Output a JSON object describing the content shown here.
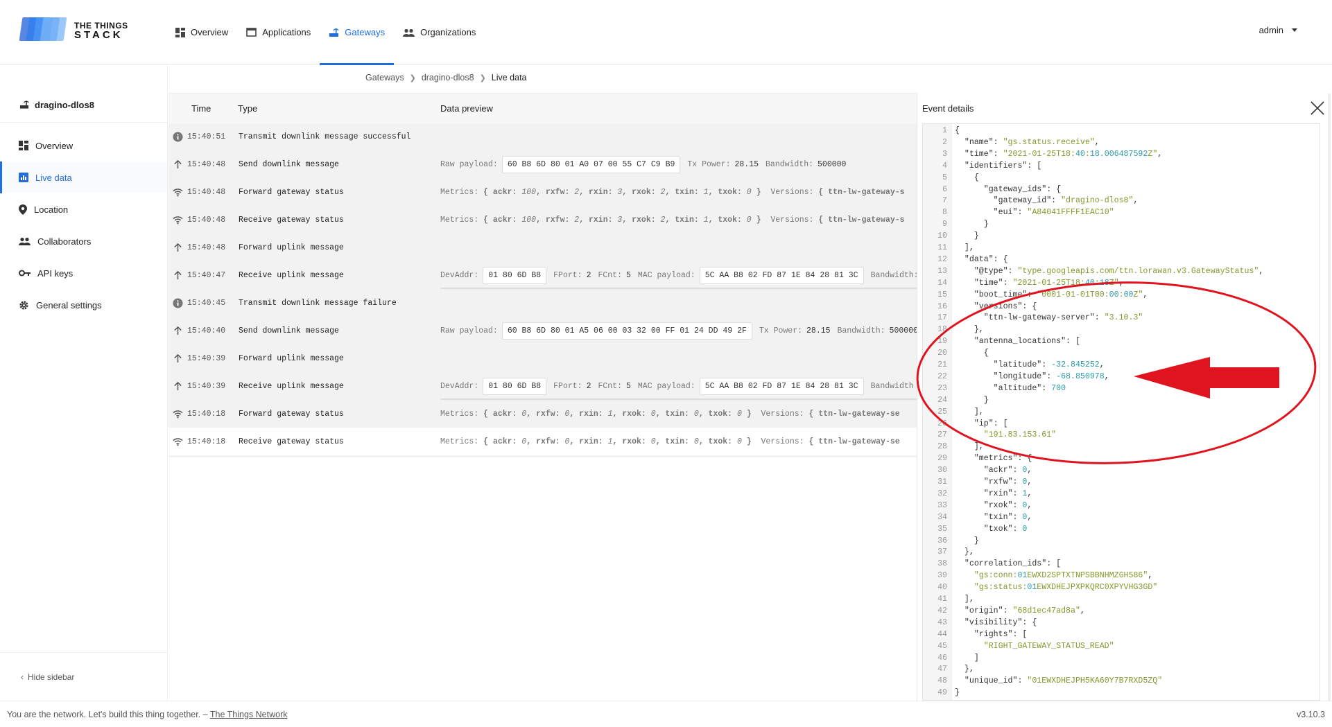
{
  "header": {
    "logo_line1": "THE THINGS",
    "logo_line2": "STACK",
    "nav": [
      {
        "label": "Overview",
        "icon": "dashboard-icon",
        "active": false
      },
      {
        "label": "Applications",
        "icon": "window-icon",
        "active": false
      },
      {
        "label": "Gateways",
        "icon": "router-icon",
        "active": true
      },
      {
        "label": "Organizations",
        "icon": "people-icon",
        "active": false
      }
    ],
    "user": "admin",
    "accent": "#1f6fe0"
  },
  "sidebar": {
    "gateway_name": "dragino-dlos8",
    "items": [
      {
        "label": "Overview",
        "icon": "dashboard-icon"
      },
      {
        "label": "Live data",
        "icon": "chart-icon"
      },
      {
        "label": "Location",
        "icon": "pin-icon"
      },
      {
        "label": "Collaborators",
        "icon": "people-icon"
      },
      {
        "label": "API keys",
        "icon": "key-icon"
      },
      {
        "label": "General settings",
        "icon": "gear-icon"
      }
    ],
    "hide_label": "Hide sidebar"
  },
  "breadcrumb": [
    "Gateways",
    "dragino-dlos8",
    "Live data"
  ],
  "table": {
    "headers": {
      "time": "Time",
      "type": "Type",
      "preview": "Data preview"
    },
    "rows": [
      {
        "icon": "info-icon",
        "time": "15:40:51",
        "type": "Transmit downlink message successful"
      },
      {
        "icon": "arrow-up-icon",
        "time": "15:40:48",
        "type": "Send downlink message"
      },
      {
        "icon": "wifi-icon",
        "time": "15:40:48",
        "type": "Forward gateway status"
      },
      {
        "icon": "wifi-icon",
        "time": "15:40:48",
        "type": "Receive gateway status"
      },
      {
        "icon": "arrow-up-icon",
        "time": "15:40:48",
        "type": "Forward uplink message"
      },
      {
        "icon": "arrow-up-icon",
        "time": "15:40:47",
        "type": "Receive uplink message"
      },
      {
        "icon": "info-icon",
        "time": "15:40:45",
        "type": "Transmit downlink message failure"
      },
      {
        "icon": "arrow-up-icon",
        "time": "15:40:40",
        "type": "Send downlink message"
      },
      {
        "icon": "arrow-up-icon",
        "time": "15:40:39",
        "type": "Forward uplink message"
      },
      {
        "icon": "arrow-up-icon",
        "time": "15:40:39",
        "type": "Receive uplink message"
      },
      {
        "icon": "wifi-icon",
        "time": "15:40:18",
        "type": "Forward gateway status"
      },
      {
        "icon": "wifi-icon",
        "time": "15:40:18",
        "type": "Receive gateway status"
      }
    ],
    "previews": {
      "raw_label": "Raw payload:",
      "tx_label": "Tx Power:",
      "bw_label": "Bandwidth:",
      "raw1": "60 B8 6D 80 01 A0 07 00 55 C7 C9 B9",
      "tx1": "28.15",
      "bw1": "500000",
      "raw2": "60 B8 6D 80 01 A5 06 00 03 32 00 FF 01 24 DD 49 2F",
      "tx2": "28.15",
      "bw2": "500000",
      "metrics_label": "Metrics:",
      "versions_label": "Versions:",
      "versions_val": "{ ttn-lw-gateway-s",
      "versions_val2": "{ ttn-lw-gateway-se",
      "m1": {
        "ackr": "100",
        "rxfw": "2",
        "rxin": "3",
        "rxok": "2",
        "txin": "1",
        "txok": "0"
      },
      "m2": {
        "ackr": "0",
        "rxfw": "0",
        "rxin": "1",
        "rxok": "0",
        "txin": "0",
        "txok": "0"
      },
      "devaddr_label": "DevAddr:",
      "devaddr": "01 80 6D B8",
      "fport_label": "FPort:",
      "fport": "2",
      "fcnt_label": "FCnt:",
      "fcnt": "5",
      "mac_label": "MAC payload:",
      "mac": "5C AA B8 02 FD 87 1E 84 28 81 3C",
      "bw_cut": "Bandwidth:",
      "bw_cut2": "Bandwidth"
    }
  },
  "event_details": {
    "title": "Event details",
    "lines": [
      "{",
      "  \"name\": \"gs.status.receive\",",
      "  \"time\": \"2021-01-25T18:40:18.006487592Z\",",
      "  \"identifiers\": [",
      "    {",
      "      \"gateway_ids\": {",
      "        \"gateway_id\": \"dragino-dlos8\",",
      "        \"eui\": \"A84041FFFF1EAC10\"",
      "      }",
      "    }",
      "  ],",
      "  \"data\": {",
      "    \"@type\": \"type.googleapis.com/ttn.lorawan.v3.GatewayStatus\",",
      "    \"time\": \"2021-01-25T18:40:18Z\",",
      "    \"boot_time\": \"0001-01-01T00:00:00Z\",",
      "    \"versions\": {",
      "      \"ttn-lw-gateway-server\": \"3.10.3\"",
      "    },",
      "    \"antenna_locations\": [",
      "      {",
      "        \"latitude\": -32.845252,",
      "        \"longitude\": -68.850978,",
      "        \"altitude\": 700",
      "      }",
      "    ],",
      "    \"ip\": [",
      "      \"191.83.153.61\"",
      "    ],",
      "    \"metrics\": {",
      "      \"ackr\": 0,",
      "      \"rxfw\": 0,",
      "      \"rxin\": 1,",
      "      \"rxok\": 0,",
      "      \"txin\": 0,",
      "      \"txok\": 0",
      "    }",
      "  },",
      "  \"correlation_ids\": [",
      "    \"gs:conn:01EWXD2SPTXTNPSBBNHMZGH586\",",
      "    \"gs:status:01EWXDHEJPXPKQRC0XPYVHG3GD\"",
      "  ],",
      "  \"origin\": \"68d1ec47ad8a\",",
      "  \"visibility\": {",
      "    \"rights\": [",
      "      \"RIGHT_GATEWAY_STATUS_READ\"",
      "    ]",
      "  },",
      "  \"unique_id\": \"01EWXDHEJPH5KA60Y7B7RXD5ZQ\"",
      "}"
    ],
    "annotation_color": "#e0141e"
  },
  "footer": {
    "text": "You are the network. Let's build this thing together. –",
    "link": "The Things Network",
    "version": "v3.10.3"
  }
}
